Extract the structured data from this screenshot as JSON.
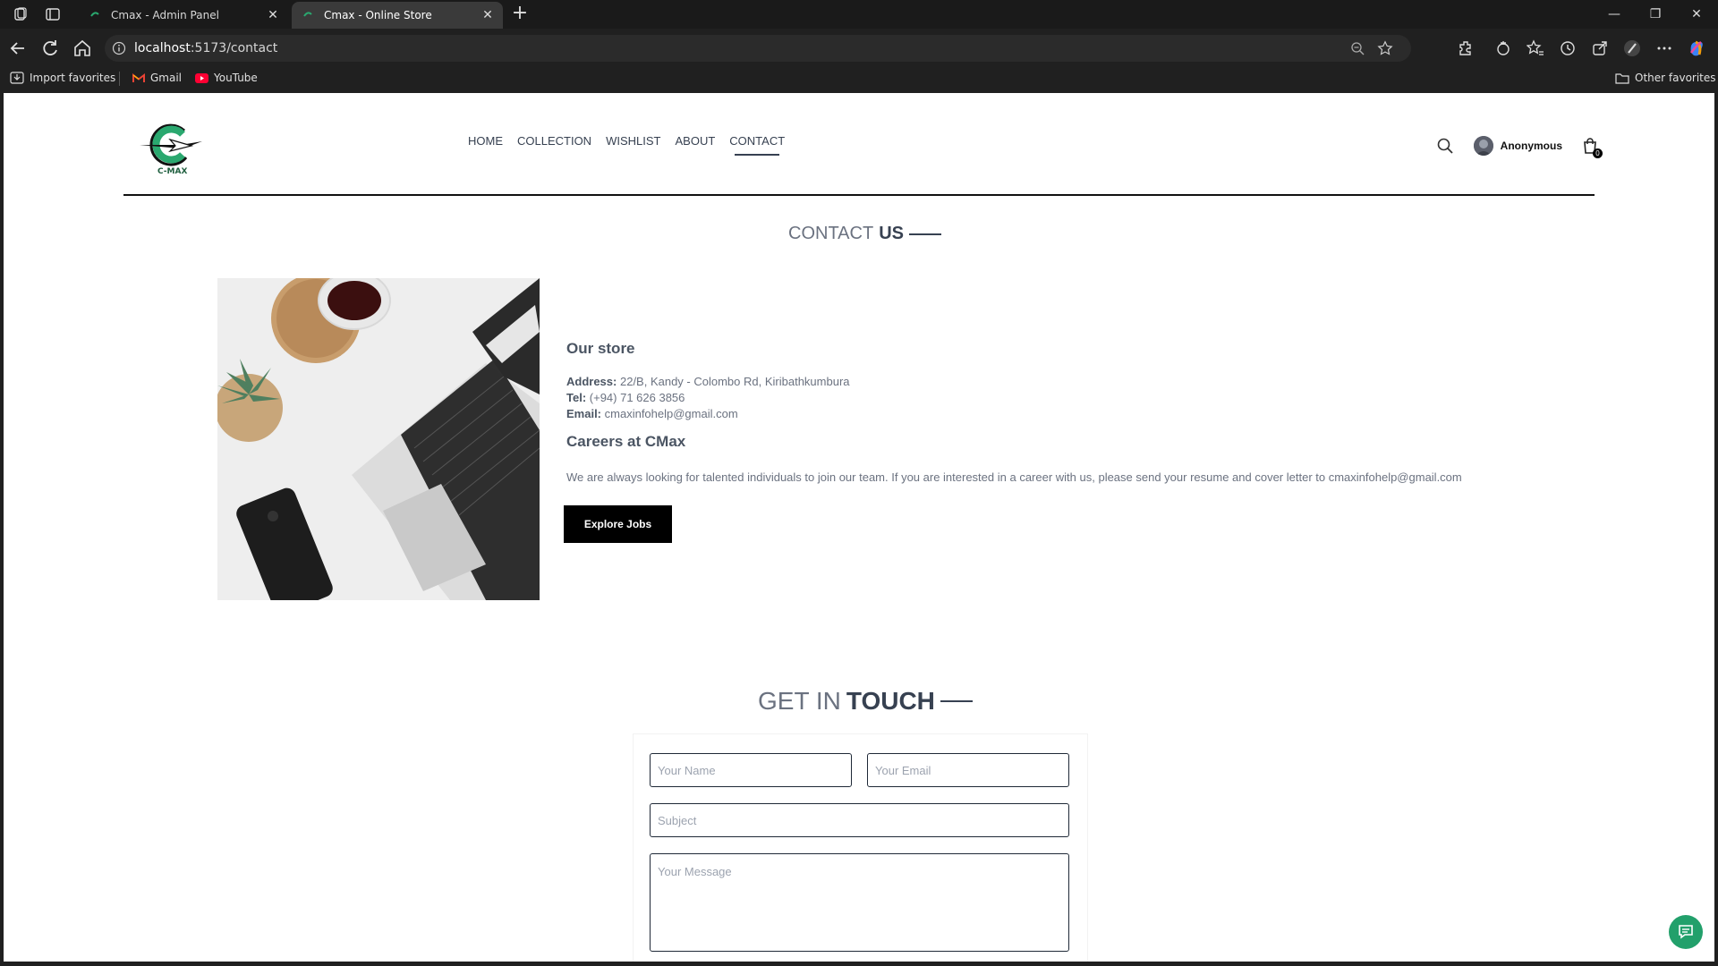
{
  "browser": {
    "tabs": [
      {
        "title": "Cmax - Admin Panel",
        "active": false
      },
      {
        "title": "Cmax - Online Store",
        "active": true
      }
    ],
    "url_host": "localhost",
    "url_rest": ":5173/contact",
    "bookmarks": [
      "Import favorites",
      "Gmail",
      "YouTube"
    ],
    "other_favorites": "Other favorites"
  },
  "site": {
    "logo_text": "C-MAX",
    "nav": [
      "HOME",
      "COLLECTION",
      "WISHLIST",
      "ABOUT",
      "CONTACT"
    ],
    "active_nav": "CONTACT",
    "user_name": "Anonymous",
    "cart_count": "0"
  },
  "contact": {
    "title_light": "CONTACT",
    "title_bold": "US",
    "store_heading": "Our store",
    "address_label": "Address:",
    "address_value": "22/B, Kandy - Colombo Rd, Kiribathkumbura",
    "tel_label": "Tel:",
    "tel_value": "(+94) 71 626 3856",
    "email_label": "Email:",
    "email_value": "cmaxinfohelp@gmail.com",
    "careers_heading": "Careers at CMax",
    "careers_text": "We are always looking for talented individuals to join our team. If you are interested in a career with us, please send your resume and cover letter to cmaxinfohelp@gmail.com",
    "button_label": "Explore Jobs"
  },
  "touch": {
    "title_light": "GET IN",
    "title_bold": "TOUCH",
    "name_placeholder": "Your Name",
    "email_placeholder": "Your Email",
    "subject_placeholder": "Subject",
    "message_placeholder": "Your Message"
  },
  "colors": {
    "chat_button": "#22a06b",
    "browser_frame": "#202020"
  }
}
